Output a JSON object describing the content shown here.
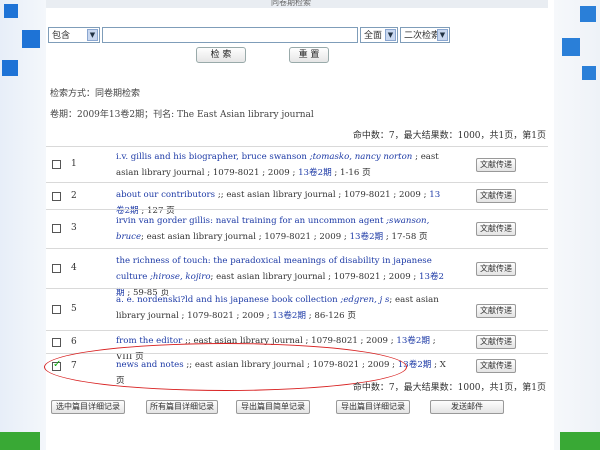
{
  "title_strip": "同卷期检索",
  "search": {
    "match_mode": "包含",
    "query": "",
    "field": "全面",
    "mode": "二次检索",
    "search_button": "检 索",
    "reset_button": "重 置"
  },
  "info": {
    "method": "检索方式：同卷期检索",
    "issue": "卷期：2009年13卷2期；刊名: The East Asian library journal"
  },
  "stats_top": "命中数：7，最大结果数：1000，共1页，第1页",
  "stats_bottom": "命中数：7，最大结果数：1000，共1页，第1页",
  "send_label": "文献传递",
  "records": [
    {
      "num": "1",
      "title": "i.v. gillis and his biographer, bruce swanson",
      "authors": ";tomasko, nancy norton",
      "source": "; east asian library journal ; 1079-8021 ; 2009 ; ",
      "issue": "13卷2期",
      "pages": " ; 1-16 页",
      "checked": false
    },
    {
      "num": "2",
      "title": "about our contributors",
      "authors": "",
      "source": " ;; east asian library journal ; 1079-8021 ; 2009 ; ",
      "issue": "13卷2期",
      "pages": " ; 127 页",
      "checked": false
    },
    {
      "num": "3",
      "title": "irvin van gorder gillis: naval training for an uncommon agent",
      "authors": ";swanson, bruce",
      "source": "; east asian library journal ; 1079-8021 ; 2009 ; ",
      "issue": "13卷2期",
      "pages": " ; 17-58 页",
      "checked": false
    },
    {
      "num": "4",
      "title": "the richness of touch: the paradoxical meanings of disability in japanese culture",
      "authors": ";hirose, kojiro",
      "source": "; east asian library journal ; 1079-8021 ; 2009 ; ",
      "issue": "13卷2期",
      "pages": " ; 59-85 页",
      "checked": false
    },
    {
      "num": "5",
      "title": "a. e. nordenski?ld and his japanese book collection",
      "authors": ";edgren, j s",
      "source": "; east asian library journal ; 1079-8021 ; 2009 ; ",
      "issue": "13卷2期",
      "pages": " ; 86-126 页",
      "checked": false
    },
    {
      "num": "6",
      "title": "from the editor",
      "authors": "",
      "source": " ;; east asian library journal ; 1079-8021 ; 2009 ; ",
      "issue": "13卷2期",
      "pages": " ; VIII 页",
      "checked": false
    },
    {
      "num": "7",
      "title": "news and notes",
      "authors": "",
      "source": " ;; east asian library journal ; 1079-8021 ; 2009 ; ",
      "issue": "13卷2期",
      "pages": " ; X 页",
      "checked": true
    }
  ],
  "bottom_buttons": [
    "选中篇目详细记录",
    "所有篇目详细记录",
    "导出篇目简单记录",
    "导出篇目详细记录",
    "发送邮件"
  ]
}
